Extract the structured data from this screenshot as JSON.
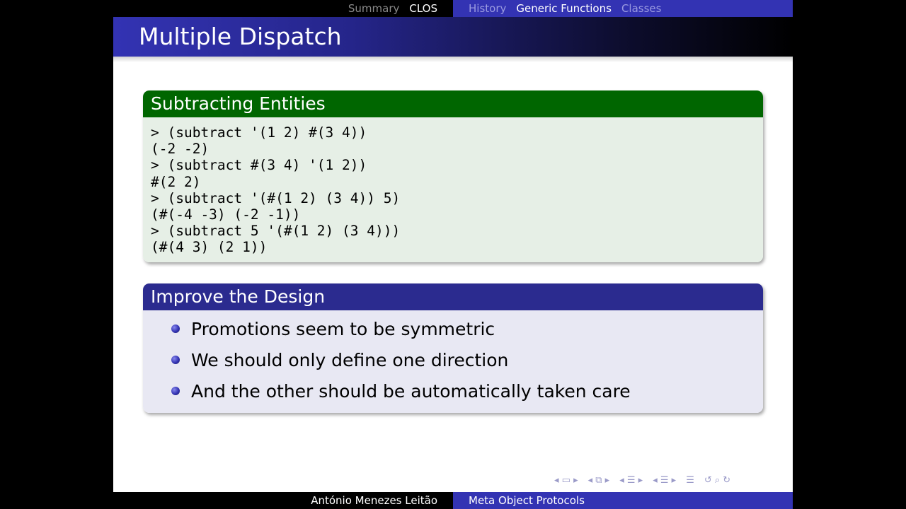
{
  "nav": {
    "left": [
      "Summary",
      "CLOS"
    ],
    "right": [
      "History",
      "Generic Functions",
      "Classes"
    ]
  },
  "title": "Multiple Dispatch",
  "example_block": {
    "heading": "Subtracting Entities",
    "lines": [
      "> (subtract '(1 2) #(3 4))",
      "(-2 -2)",
      "> (subtract #(3 4) '(1 2))",
      "#(2 2)",
      "> (subtract '(#(1 2) (3 4)) 5)",
      "(#(-4 -3) (-2 -1))",
      "> (subtract 5 '(#(1 2) (3 4)))",
      "(#(4 3) (2 1))"
    ]
  },
  "design_block": {
    "heading": "Improve the Design",
    "items": [
      "Promotions seem to be symmetric",
      "We should only define one direction",
      "And the other should be automatically taken care"
    ]
  },
  "footer": {
    "author": "António Menezes Leitão",
    "talk": "Meta Object Protocols"
  },
  "colors": {
    "nav_blue": "#3333b3",
    "example_head": "#006600",
    "example_body": "#e6efe6",
    "block_head": "#2b2b8f",
    "block_body": "#e8e8f3"
  }
}
